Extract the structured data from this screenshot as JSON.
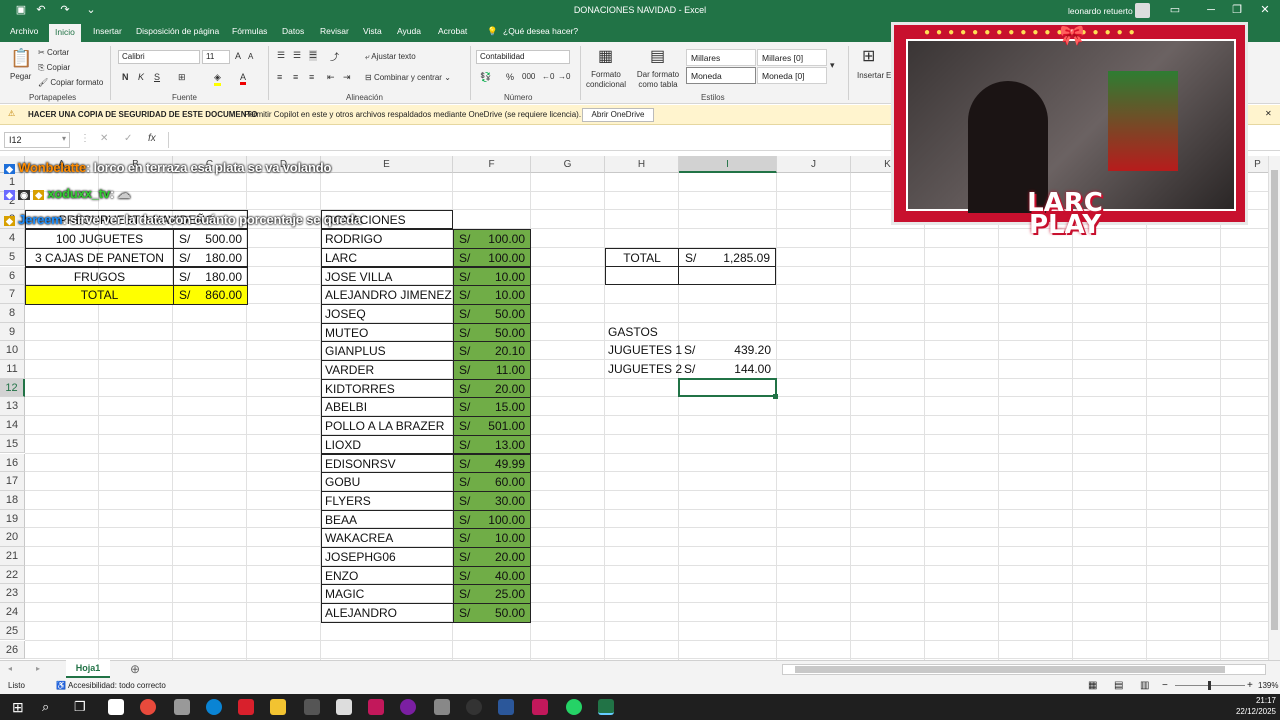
{
  "window": {
    "title": "DONACIONES NAVIDAD",
    "app": "Excel",
    "user": "leonardo retuerto"
  },
  "tabs": [
    "Archivo",
    "Inicio",
    "Insertar",
    "Disposición de página",
    "Fórmulas",
    "Datos",
    "Revisar",
    "Vista",
    "Ayuda",
    "Acrobat",
    "¿Qué desea hacer?"
  ],
  "ribbon": {
    "clipboard": {
      "paste": "Pegar",
      "cut": "Cortar",
      "copy": "Copiar",
      "format_painter": "Copiar formato",
      "group": "Portapapeles"
    },
    "font": {
      "name": "Calibri",
      "size": "11",
      "group": "Fuente"
    },
    "alignment": {
      "wrap": "Ajustar texto",
      "merge": "Combinar y centrar",
      "group": "Alineación"
    },
    "number": {
      "format": "Contabilidad",
      "group": "Número"
    },
    "styles": {
      "cond": "Formato condicional",
      "table": "Dar formato como tabla",
      "s1": "Millares",
      "s2": "Millares [0]",
      "s3": "Moneda",
      "s4": "Moneda [0]",
      "group": "Estilos"
    },
    "cells": {
      "insert": "Insertar",
      "delete": "Eli"
    }
  },
  "security": {
    "title": "HACER UNA COPIA DE SEGURIDAD DE ESTE DOCUMENTO",
    "message": "Permitir Copilot en este y otros archivos respaldados mediante OneDrive (se requiere licencia).",
    "button": "Abrir OneDrive"
  },
  "formula": {
    "namebox": "I12",
    "fx": "fx"
  },
  "columns": [
    "A",
    "B",
    "C",
    "D",
    "E",
    "F",
    "G",
    "H",
    "I",
    "J",
    "K",
    "L",
    "M",
    "N",
    "O",
    "P"
  ],
  "rows": [
    "1",
    "2",
    "3",
    "4",
    "5",
    "6",
    "7",
    "8",
    "9",
    "10",
    "11",
    "12",
    "13",
    "14",
    "15",
    "16",
    "17",
    "18",
    "19",
    "20",
    "21",
    "22",
    "23",
    "24",
    "25",
    "26"
  ],
  "budget": {
    "header": "PRESUPUESTO NAVIDEÑO",
    "items": [
      {
        "desc": "100 JUGUETES",
        "cur": "S/",
        "amt": "500.00"
      },
      {
        "desc": "3 CAJAS DE PANETON",
        "cur": "S/",
        "amt": "180.00"
      },
      {
        "desc": "FRUGOS",
        "cur": "S/",
        "amt": "180.00"
      }
    ],
    "total": {
      "label": "TOTAL",
      "cur": "S/",
      "amt": "860.00"
    }
  },
  "donations": {
    "header": "DONACIONES",
    "items": [
      {
        "name": "RODRIGO",
        "cur": "S/",
        "amt": "100.00"
      },
      {
        "name": "LARC",
        "cur": "S/",
        "amt": "100.00"
      },
      {
        "name": "JOSE VILLA",
        "cur": "S/",
        "amt": "10.00"
      },
      {
        "name": "ALEJANDRO JIMENEZ",
        "cur": "S/",
        "amt": "10.00"
      },
      {
        "name": "JOSEQ",
        "cur": "S/",
        "amt": "50.00"
      },
      {
        "name": "MUTEO",
        "cur": "S/",
        "amt": "50.00"
      },
      {
        "name": "GIANPLUS",
        "cur": "S/",
        "amt": "20.10"
      },
      {
        "name": "VARDER",
        "cur": "S/",
        "amt": "11.00"
      },
      {
        "name": "KIDTORRES",
        "cur": "S/",
        "amt": "20.00"
      },
      {
        "name": "ABELBI",
        "cur": "S/",
        "amt": "15.00"
      },
      {
        "name": "POLLO A LA BRAZER",
        "cur": "S/",
        "amt": "501.00"
      },
      {
        "name": "LIOXD",
        "cur": "S/",
        "amt": "13.00"
      },
      {
        "name": "EDISONRSV",
        "cur": "S/",
        "amt": "49.99"
      },
      {
        "name": "GOBU",
        "cur": "S/",
        "amt": "60.00"
      },
      {
        "name": "FLYERS",
        "cur": "S/",
        "amt": "30.00"
      },
      {
        "name": "BEAA",
        "cur": "S/",
        "amt": "100.00"
      },
      {
        "name": "WAKACREA",
        "cur": "S/",
        "amt": "10.00"
      },
      {
        "name": "JOSEPHG06",
        "cur": "S/",
        "amt": "20.00"
      },
      {
        "name": "ENZO",
        "cur": "S/",
        "amt": "40.00"
      },
      {
        "name": "MAGIC",
        "cur": "S/",
        "amt": "25.00"
      },
      {
        "name": "ALEJANDRO",
        "cur": "S/",
        "amt": "50.00"
      }
    ]
  },
  "summary": {
    "total_label": "TOTAL",
    "total_cur": "S/",
    "total_amt": "1,285.09",
    "gastos": "GASTOS",
    "exp1": {
      "label": "JUGUETES 1",
      "cur": "S/",
      "amt": "439.20"
    },
    "exp2": {
      "label": "JUGUETES 2",
      "cur": "S/",
      "amt": "144.00"
    }
  },
  "chat": [
    {
      "user": "Wonbelatte",
      "text": ": lorco en terraza esa plata se va volando",
      "color": "#ff8c00"
    },
    {
      "user": "xoduxx_tv",
      "text": ":",
      "color": "#32cd32"
    },
    {
      "user": "Jereem",
      "text": ": sirve ver la data con cuánto porcentaje se queda",
      "color": "#1e90ff"
    }
  ],
  "overlay": {
    "logo_line1": "LARC",
    "logo_line2": "PLAY"
  },
  "sheet": {
    "tab": "Hoja1"
  },
  "status": {
    "ready": "Listo",
    "accessibility": "Accesibilidad: todo correcto",
    "zoom": "139%",
    "time": "21:17",
    "date": "22/12/2025"
  },
  "colors": {
    "excel_green": "#217346",
    "highlight_yellow": "#ffff00",
    "donation_green": "#70ad47"
  }
}
